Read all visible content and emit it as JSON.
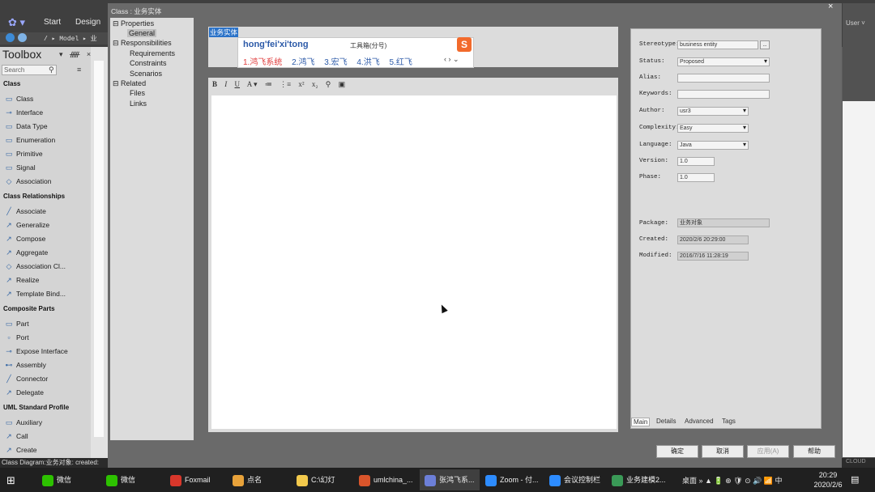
{
  "app": {
    "menu_tabs": [
      "Start",
      "Design"
    ],
    "nav_path": "/ ▸ Model ▸ 业",
    "user": "User ˅"
  },
  "toolbox": {
    "title": "Toolbox",
    "pins": "▾ ᚏ ×",
    "search_placeholder": "Search",
    "sections": [
      {
        "title": "Class",
        "items": [
          "Class",
          "Interface",
          "Data Type",
          "Enumeration",
          "Primitive",
          "Signal",
          "Association"
        ]
      },
      {
        "title": "Class Relationships",
        "items": [
          "Associate",
          "Generalize",
          "Compose",
          "Aggregate",
          "Association Cl...",
          "Realize",
          "Template Bind..."
        ]
      },
      {
        "title": "Composite Parts",
        "items": [
          "Part",
          "Port",
          "Expose Interface",
          "Assembly",
          "Connector",
          "Delegate"
        ]
      },
      {
        "title": "UML Standard Profile",
        "items": [
          "Auxiliary",
          "Call",
          "Create"
        ]
      }
    ]
  },
  "dialog": {
    "title": "Class : 业务实体",
    "close": "×",
    "tree": {
      "properties": "Properties",
      "general": "General",
      "responsibilities": "Responsibilities",
      "requirements": "Requirements",
      "constraints": "Constraints",
      "scenarios": "Scenarios",
      "related": "Related",
      "files": "Files",
      "links": "Links"
    },
    "name_value": "业务实体",
    "ime": {
      "pinyin": "hong'fei'xi'tong",
      "hint": "工具箱(分号)",
      "logo": "S",
      "candidates": [
        "1.鸿飞系统",
        "2.鸿飞",
        "3.宏飞",
        "4.洪飞",
        "5.红飞"
      ],
      "nav": "‹ › ⌄"
    },
    "editor_toolbar": [
      "B",
      "I",
      "U",
      "A ▾",
      "≔",
      "⋮≡",
      "x²",
      "x₂",
      "⚲",
      "▣"
    ],
    "properties": {
      "stereotype_label": "Stereotype:",
      "stereotype": "business entity",
      "stereotype_btn": "..",
      "status_label": "Status:",
      "status": "Proposed",
      "alias_label": "Alias:",
      "alias": "",
      "keywords_label": "Keywords:",
      "keywords": "",
      "author_label": "Author:",
      "author": "usr3",
      "complexity_label": "Complexity:",
      "complexity": "Easy",
      "language_label": "Language:",
      "language": "Java",
      "version_label": "Version:",
      "version": "1.0",
      "phase_label": "Phase:",
      "phase": "1.0",
      "package_label": "Package:",
      "package": "业务对象",
      "created_label": "Created:",
      "created": "2020/2/6 20:29:00",
      "modified_label": "Modified:",
      "modified": "2016/7/16 11:28:19"
    },
    "prop_tabs": [
      "Main",
      "Details",
      "Advanced",
      "Tags"
    ],
    "buttons": {
      "ok": "确定",
      "cancel": "取消",
      "apply": "应用(A)",
      "help": "帮助"
    }
  },
  "statusbar": "Class Diagram:业务对象:   created:",
  "taskbar": {
    "items": [
      {
        "label": "微信",
        "color": "#2dc100"
      },
      {
        "label": "微信",
        "color": "#2dc100"
      },
      {
        "label": "Foxmail",
        "color": "#d8372b"
      },
      {
        "label": "点名",
        "color": "#e8a23a"
      },
      {
        "label": "C:\\幻灯",
        "color": "#f2c94c"
      },
      {
        "label": "umlchina_...",
        "color": "#d9552b"
      },
      {
        "label": "张鸿飞系...",
        "color": "#6c7fd8"
      },
      {
        "label": "Zoom - 付...",
        "color": "#2d8cff"
      },
      {
        "label": "会议控制栏",
        "color": "#2d8cff"
      },
      {
        "label": "业务建模2...",
        "color": "#3a9a57"
      }
    ],
    "tray_text": "桌面  »  ▲ 🔋 ⊕ 🛡 ⊙ 🔊 📶 中",
    "time": "20:29",
    "date": "2020/2/6",
    "right_labels": [
      "CLOUD"
    ]
  }
}
